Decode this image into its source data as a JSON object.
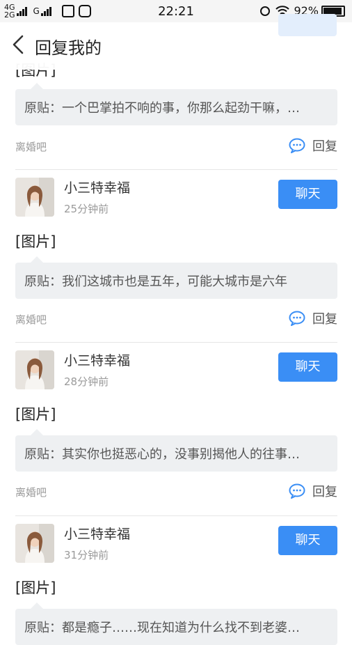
{
  "status_bar": {
    "network_1": "4G",
    "network_2": "2G",
    "network_3": "G",
    "time": "22:21",
    "battery_percent": "92%",
    "battery_level": 0.92
  },
  "header": {
    "title": "回复我的"
  },
  "top_fragment": {
    "picture_label": "[图片]",
    "quote": "原贴：一个巴掌拍不响的事，你那么起劲干嘛，…",
    "forum": "离婚吧",
    "reply_label": "回复"
  },
  "items": [
    {
      "username": "小三特幸福",
      "time": "25分钟前",
      "chat_label": "聊天",
      "picture_label": "[图片]",
      "quote": "原贴：我们这城市也是五年，可能大城市是六年",
      "forum": "离婚吧",
      "reply_label": "回复"
    },
    {
      "username": "小三特幸福",
      "time": "28分钟前",
      "chat_label": "聊天",
      "picture_label": "[图片]",
      "quote": "原贴：其实你也挺恶心的，没事别揭他人的往事…",
      "forum": "离婚吧",
      "reply_label": "回复"
    },
    {
      "username": "小三特幸福",
      "time": "31分钟前",
      "chat_label": "聊天",
      "picture_label": "[图片]",
      "quote": "原贴：都是瘾子……现在知道为什么找不到老婆…"
    }
  ],
  "colors": {
    "accent": "#3a8ef5",
    "quote_bg": "#eef0f2",
    "muted": "#9a9a9a"
  }
}
